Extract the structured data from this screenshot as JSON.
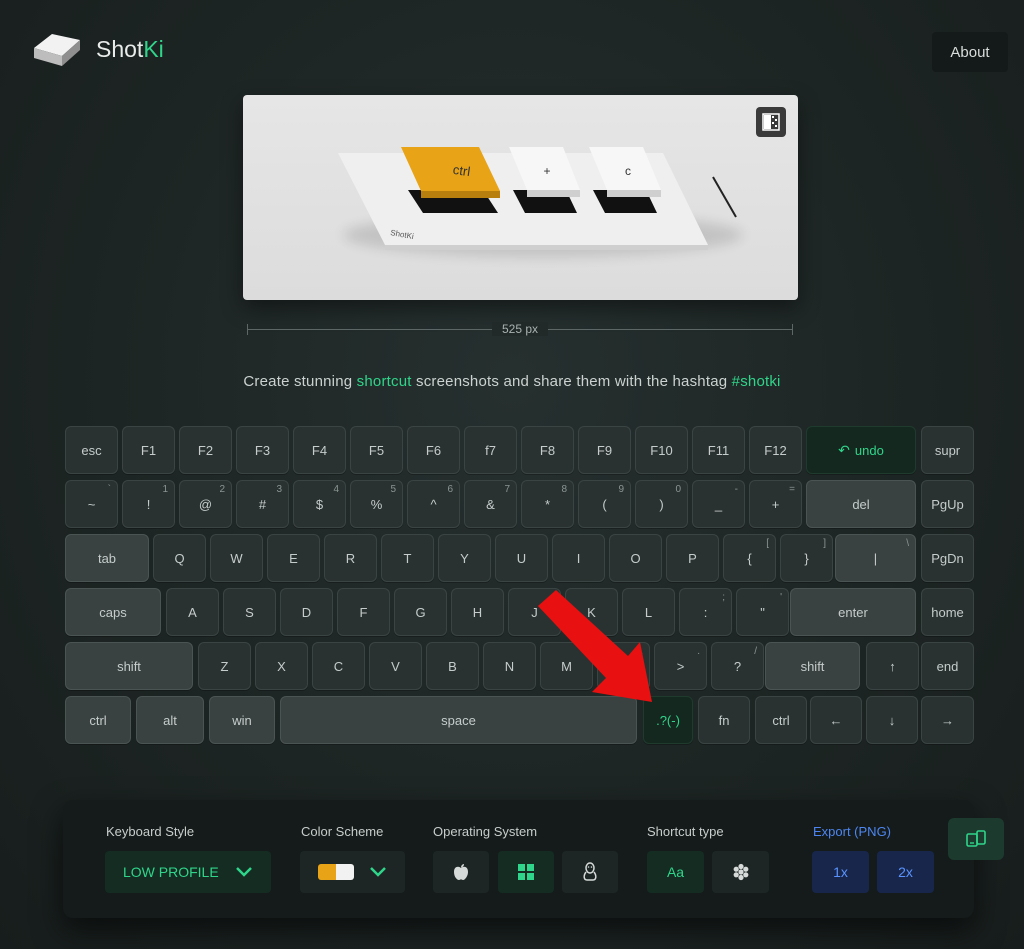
{
  "brand": {
    "name_part1": "Shot",
    "name_part2": "Ki"
  },
  "header": {
    "about_label": "About"
  },
  "preview": {
    "keys": [
      "ctrl",
      "+",
      "c"
    ],
    "watermark": "ShotKi",
    "width_label": "525 px"
  },
  "tagline": {
    "part1": "Create stunning ",
    "highlight1": "shortcut",
    "part2": " screenshots and share them with the hashtag ",
    "highlight2": "#shotki"
  },
  "keyboard": {
    "undo_label": "undo",
    "rows": [
      [
        {
          "label": "esc",
          "sub": ""
        },
        {
          "label": "F1",
          "sub": ""
        },
        {
          "label": "F2",
          "sub": ""
        },
        {
          "label": "F3",
          "sub": ""
        },
        {
          "label": "F4",
          "sub": ""
        },
        {
          "label": "F5",
          "sub": ""
        },
        {
          "label": "F6",
          "sub": ""
        },
        {
          "label": "f7",
          "sub": ""
        },
        {
          "label": "F8",
          "sub": ""
        },
        {
          "label": "F9",
          "sub": ""
        },
        {
          "label": "F10",
          "sub": ""
        },
        {
          "label": "F11",
          "sub": ""
        },
        {
          "label": "F12",
          "sub": ""
        },
        {
          "label": "undo",
          "sub": ""
        },
        {
          "label": "supr",
          "sub": ""
        }
      ],
      [
        {
          "label": "~",
          "sub": "`"
        },
        {
          "label": "!",
          "sub": "1"
        },
        {
          "label": "@",
          "sub": "2"
        },
        {
          "label": "#",
          "sub": "3"
        },
        {
          "label": "$",
          "sub": "4"
        },
        {
          "label": "%",
          "sub": "5"
        },
        {
          "label": "^",
          "sub": "6"
        },
        {
          "label": "&",
          "sub": "7"
        },
        {
          "label": "*",
          "sub": "8"
        },
        {
          "label": "(",
          "sub": "9"
        },
        {
          "label": ")",
          "sub": "0"
        },
        {
          "label": "_",
          "sub": "-"
        },
        {
          "label": "+",
          "sub": "="
        },
        {
          "label": "del",
          "sub": ""
        },
        {
          "label": "PgUp",
          "sub": ""
        }
      ],
      [
        {
          "label": "tab",
          "sub": ""
        },
        {
          "label": "Q",
          "sub": ""
        },
        {
          "label": "W",
          "sub": ""
        },
        {
          "label": "E",
          "sub": ""
        },
        {
          "label": "R",
          "sub": ""
        },
        {
          "label": "T",
          "sub": ""
        },
        {
          "label": "Y",
          "sub": ""
        },
        {
          "label": "U",
          "sub": ""
        },
        {
          "label": "I",
          "sub": ""
        },
        {
          "label": "O",
          "sub": ""
        },
        {
          "label": "P",
          "sub": ""
        },
        {
          "label": "{",
          "sub": "["
        },
        {
          "label": "}",
          "sub": "]"
        },
        {
          "label": "|",
          "sub": "\\"
        },
        {
          "label": "PgDn",
          "sub": ""
        }
      ],
      [
        {
          "label": "caps",
          "sub": ""
        },
        {
          "label": "A",
          "sub": ""
        },
        {
          "label": "S",
          "sub": ""
        },
        {
          "label": "D",
          "sub": ""
        },
        {
          "label": "F",
          "sub": ""
        },
        {
          "label": "G",
          "sub": ""
        },
        {
          "label": "H",
          "sub": ""
        },
        {
          "label": "J",
          "sub": ""
        },
        {
          "label": "K",
          "sub": ""
        },
        {
          "label": "L",
          "sub": ""
        },
        {
          "label": ":",
          "sub": ";"
        },
        {
          "label": "\"",
          "sub": "'"
        },
        {
          "label": "enter",
          "sub": ""
        },
        {
          "label": "home",
          "sub": ""
        }
      ],
      [
        {
          "label": "shift",
          "sub": ""
        },
        {
          "label": "Z",
          "sub": ""
        },
        {
          "label": "X",
          "sub": ""
        },
        {
          "label": "C",
          "sub": ""
        },
        {
          "label": "V",
          "sub": ""
        },
        {
          "label": "B",
          "sub": ""
        },
        {
          "label": "N",
          "sub": ""
        },
        {
          "label": "M",
          "sub": ""
        },
        {
          "label": "<",
          "sub": ","
        },
        {
          "label": ">",
          "sub": "."
        },
        {
          "label": "?",
          "sub": "/"
        },
        {
          "label": "shift",
          "sub": ""
        },
        {
          "label": "↑",
          "sub": ""
        },
        {
          "label": "end",
          "sub": ""
        }
      ],
      [
        {
          "label": "ctrl",
          "sub": ""
        },
        {
          "label": "alt",
          "sub": ""
        },
        {
          "label": "win",
          "sub": ""
        },
        {
          "label": "space",
          "sub": ""
        },
        {
          "label": ".?(-)",
          "sub": ""
        },
        {
          "label": "fn",
          "sub": ""
        },
        {
          "label": "ctrl",
          "sub": ""
        },
        {
          "label": "←",
          "sub": ""
        },
        {
          "label": "↓",
          "sub": ""
        },
        {
          "label": "→",
          "sub": ""
        }
      ]
    ]
  },
  "controls": {
    "keyboard_style": {
      "label": "Keyboard Style",
      "value": "LOW PROFILE"
    },
    "color_scheme": {
      "label": "Color Scheme",
      "swatch_colors": [
        "#e8a317",
        "#f2f2f2"
      ]
    },
    "operating_system": {
      "label": "Operating System",
      "options": [
        "apple-icon",
        "windows-icon",
        "linux-icon"
      ],
      "selected": "windows-icon"
    },
    "shortcut_type": {
      "label": "Shortcut type",
      "text_option": "Aa",
      "icon_option": "flower-icon"
    },
    "export": {
      "label": "Export (PNG)",
      "options": [
        "1x",
        "2x"
      ]
    }
  },
  "colors": {
    "accent": "#2fd58a",
    "export_blue": "#4d86f2",
    "key_highlight": "#e8a317",
    "arrow": "#e81010"
  }
}
